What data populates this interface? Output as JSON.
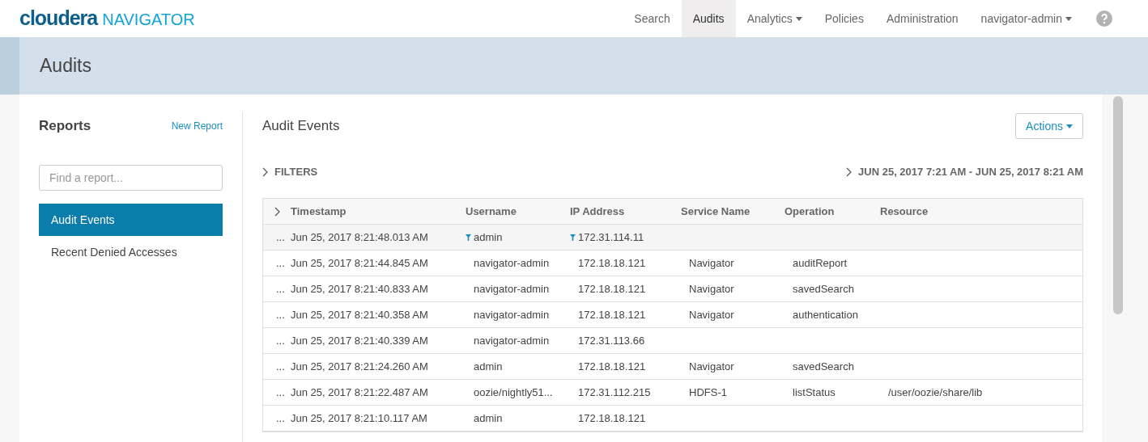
{
  "brand": {
    "name": "cloudera",
    "product": "NAVIGATOR"
  },
  "nav": [
    {
      "label": "Search",
      "selected": false,
      "dropdown": false
    },
    {
      "label": "Audits",
      "selected": true,
      "dropdown": false
    },
    {
      "label": "Analytics",
      "selected": false,
      "dropdown": true
    },
    {
      "label": "Policies",
      "selected": false,
      "dropdown": false
    },
    {
      "label": "Administration",
      "selected": false,
      "dropdown": false
    },
    {
      "label": "navigator-admin",
      "selected": false,
      "dropdown": true
    }
  ],
  "page_title": "Audits",
  "sidebar": {
    "title": "Reports",
    "new_report": "New Report",
    "search": {
      "placeholder": "Find a report..."
    },
    "items": [
      {
        "label": "Audit Events",
        "selected": true
      },
      {
        "label": "Recent Denied Accesses",
        "selected": false
      }
    ]
  },
  "main": {
    "title": "Audit Events",
    "actions": "Actions",
    "filters": "FILTERS",
    "date_range": "JUN 25, 2017 7:21 AM - JUN 25, 2017 8:21 AM",
    "table": {
      "columns": [
        "Timestamp",
        "Username",
        "IP Address",
        "Service Name",
        "Operation",
        "Resource"
      ],
      "rows": [
        {
          "more": "...",
          "highlighted": true,
          "cells": [
            {
              "text": "Jun 25, 2017 8:21:48.013 AM",
              "filter": false
            },
            {
              "text": "admin",
              "filter": true
            },
            {
              "text": "172.31.114.11",
              "filter": true
            }
          ]
        },
        {
          "more": "...",
          "highlighted": false,
          "cells": [
            {
              "text": "Jun 25, 2017 8:21:44.845 AM",
              "filter": false
            },
            {
              "text": "navigator-admin",
              "filter": false
            },
            {
              "text": "172.18.18.121",
              "filter": false
            },
            {
              "text": "Navigator",
              "filter": false
            },
            {
              "text": "auditReport",
              "filter": false
            }
          ]
        },
        {
          "more": "...",
          "highlighted": false,
          "cells": [
            {
              "text": "Jun 25, 2017 8:21:40.833 AM",
              "filter": false
            },
            {
              "text": "navigator-admin",
              "filter": false
            },
            {
              "text": "172.18.18.121",
              "filter": false
            },
            {
              "text": "Navigator",
              "filter": false
            },
            {
              "text": "savedSearch",
              "filter": false
            }
          ]
        },
        {
          "more": "...",
          "highlighted": false,
          "cells": [
            {
              "text": "Jun 25, 2017 8:21:40.358 AM",
              "filter": false
            },
            {
              "text": "navigator-admin",
              "filter": false
            },
            {
              "text": "172.18.18.121",
              "filter": false
            },
            {
              "text": "Navigator",
              "filter": false
            },
            {
              "text": "authentication",
              "filter": false
            }
          ]
        },
        {
          "more": "...",
          "highlighted": false,
          "cells": [
            {
              "text": "Jun 25, 2017 8:21:40.339 AM",
              "filter": false
            },
            {
              "text": "navigator-admin",
              "filter": false
            },
            {
              "text": "172.31.113.66",
              "filter": false
            }
          ]
        },
        {
          "more": "...",
          "highlighted": false,
          "cells": [
            {
              "text": "Jun 25, 2017 8:21:24.260 AM",
              "filter": false
            },
            {
              "text": "admin",
              "filter": false
            },
            {
              "text": "172.18.18.121",
              "filter": false
            },
            {
              "text": "Navigator",
              "filter": false
            },
            {
              "text": "savedSearch",
              "filter": false
            }
          ]
        },
        {
          "more": "...",
          "highlighted": false,
          "cells": [
            {
              "text": "Jun 25, 2017 8:21:22.487 AM",
              "filter": false
            },
            {
              "text": "oozie/nightly51...",
              "filter": false
            },
            {
              "text": "172.31.112.215",
              "filter": false
            },
            {
              "text": "HDFS-1",
              "filter": false
            },
            {
              "text": "listStatus",
              "filter": false
            },
            {
              "text": "/user/oozie/share/lib",
              "filter": false
            }
          ]
        },
        {
          "more": "...",
          "highlighted": false,
          "cells": [
            {
              "text": "Jun 25, 2017 8:21:10.117 AM",
              "filter": false
            },
            {
              "text": "admin",
              "filter": false
            },
            {
              "text": "172.18.18.121",
              "filter": false
            }
          ]
        }
      ]
    }
  }
}
